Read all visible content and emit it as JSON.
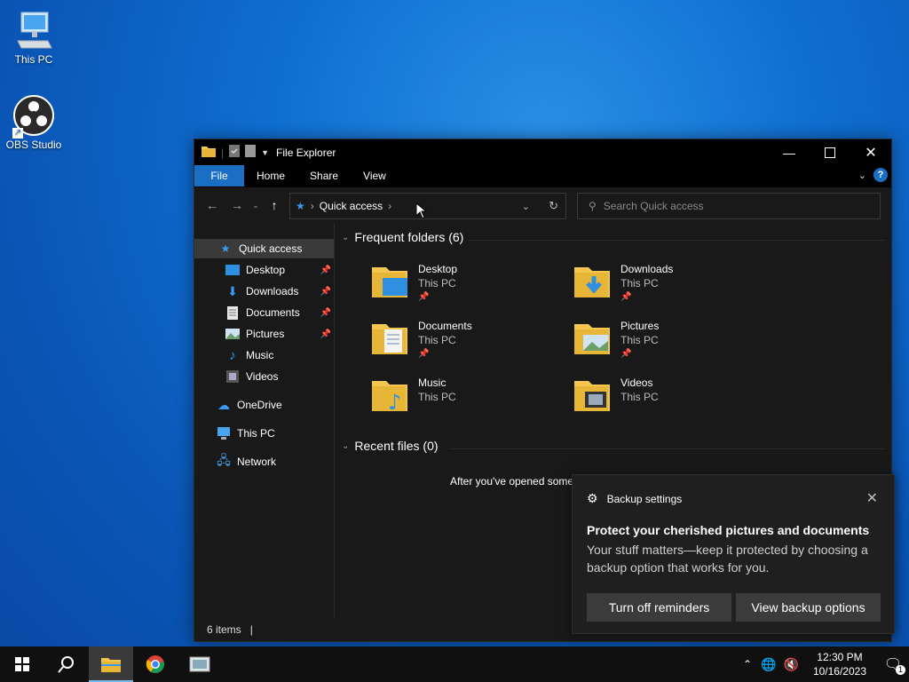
{
  "desktop": {
    "icons": [
      {
        "label": "This PC"
      },
      {
        "label": "OBS Studio"
      }
    ]
  },
  "explorer": {
    "title": "File Explorer",
    "ribbon_tabs": [
      "File",
      "Home",
      "Share",
      "View"
    ],
    "help_label": "?",
    "address": {
      "crumb": "Quick access"
    },
    "search": {
      "placeholder": "Search Quick access"
    },
    "sidebar": {
      "items": [
        {
          "label": "Quick access"
        },
        {
          "label": "Desktop"
        },
        {
          "label": "Downloads"
        },
        {
          "label": "Documents"
        },
        {
          "label": "Pictures"
        },
        {
          "label": "Music"
        },
        {
          "label": "Videos"
        },
        {
          "label": "OneDrive"
        },
        {
          "label": "This PC"
        },
        {
          "label": "Network"
        }
      ]
    },
    "frequent": {
      "heading": "Frequent folders (6)",
      "folders": [
        {
          "name": "Desktop",
          "location": "This PC"
        },
        {
          "name": "Downloads",
          "location": "This PC"
        },
        {
          "name": "Documents",
          "location": "This PC"
        },
        {
          "name": "Pictures",
          "location": "This PC"
        },
        {
          "name": "Music",
          "location": "This PC"
        },
        {
          "name": "Videos",
          "location": "This PC"
        }
      ]
    },
    "recent": {
      "heading": "Recent files (0)",
      "empty_message": "After you've opened some"
    },
    "status": {
      "items": "6 items"
    }
  },
  "toast": {
    "app": "Backup settings",
    "title": "Protect your cherished pictures and documents",
    "body": "Your stuff matters—keep it protected by choosing a backup option that works for you.",
    "btn_left": "Turn off reminders",
    "btn_right": "View backup options"
  },
  "taskbar": {
    "time": "12:30 PM",
    "date": "10/16/2023",
    "notification_count": "1"
  },
  "colors": {
    "accent": "#1a6fc4",
    "folder": "#f3c74f"
  }
}
